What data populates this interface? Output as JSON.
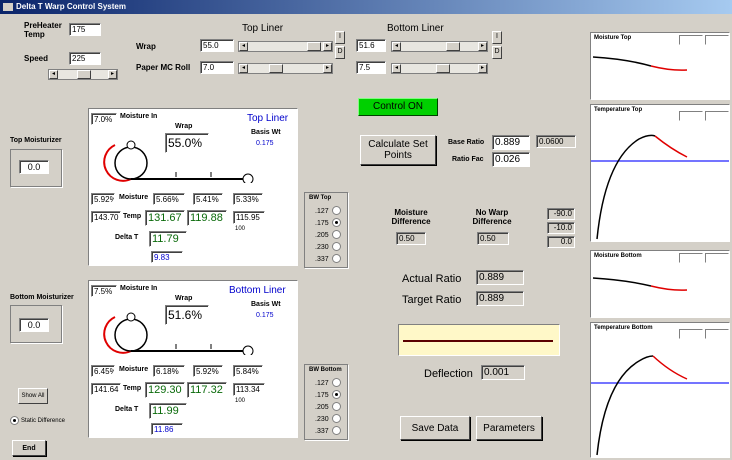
{
  "window": {
    "title": "Delta T Warp Control System"
  },
  "header": {
    "preheater_label": "PreHeater Temp",
    "preheater_value": "175",
    "speed_label": "Speed",
    "speed_value": "225",
    "wrap_label": "Wrap",
    "paper_mc_label": "Paper MC Roll",
    "top_liner_title": "Top Liner",
    "top_wrap_value": "55.0",
    "top_paper_value": "7.0",
    "bottom_liner_title": "Bottom Liner",
    "bottom_wrap_value": "51.6",
    "bottom_paper_value": "7.5",
    "i_label": "I",
    "d_label": "D"
  },
  "control_on": "Control ON",
  "calculate_label": "Calculate Set Points",
  "base_ratio_label": "Base Ratio",
  "base_ratio_value": "0.889",
  "base_ratio_extra": "0.0600",
  "ratio_fac_label": "Ratio Fac",
  "ratio_fac_value": "0.026",
  "moisture_diff_label": "Moisture Difference",
  "moisture_diff_value": "0.50",
  "no_warp_label": "No Warp Difference",
  "no_warp_value": "0.50",
  "side_values": [
    "-90.0",
    "-10.0",
    "0.0"
  ],
  "actual_ratio_label": "Actual Ratio",
  "actual_ratio_value": "0.889",
  "target_ratio_label": "Target Ratio",
  "target_ratio_value": "0.889",
  "deflection_label": "Deflection",
  "deflection_value": "0.001",
  "save_data_label": "Save Data",
  "parameters_label": "Parameters",
  "show_all_label": "Show All",
  "static_diff_label": "Static Difference",
  "end_label": "End",
  "top_moisturizer": {
    "label": "Top Moisturizer",
    "value": "0.0"
  },
  "bottom_moisturizer": {
    "label": "Bottom Moisturizer",
    "value": "0.0"
  },
  "top_panel": {
    "moisture_in_value": "7.0%",
    "moisture_in_label": "Moisture In",
    "wrap_label": "Wrap",
    "wrap_value": "55.0%",
    "title": "Top Liner",
    "basis_label": "Basis Wt",
    "basis_value": "0.175",
    "moisture_left": "5.92%",
    "moisture_label": "Moisture",
    "moisture_vals": [
      "5.66%",
      "5.41%",
      "5.33%"
    ],
    "temp_left": "143.70",
    "temp_label": "Temp",
    "temp_vals": [
      "131.67",
      "119.88",
      "115.95"
    ],
    "temp_sub": "100",
    "delta_label": "Delta T",
    "delta_value": "11.79",
    "delta_sub": "9.83"
  },
  "bottom_panel": {
    "moisture_in_value": "7.5%",
    "moisture_in_label": "Moisture In",
    "wrap_label": "Wrap",
    "wrap_value": "51.6%",
    "title": "Bottom Liner",
    "basis_label": "Basis Wt",
    "basis_value": "0.175",
    "moisture_left": "6.45%",
    "moisture_label": "Moisture",
    "moisture_vals": [
      "6.18%",
      "5.92%",
      "5.84%"
    ],
    "temp_left": "141.64",
    "temp_label": "Temp",
    "temp_vals": [
      "129.30",
      "117.32",
      "113.34"
    ],
    "temp_sub": "100",
    "delta_label": "Delta T",
    "delta_value": "11.99",
    "delta_sub": "11.86"
  },
  "bw_top": {
    "title": "BW Top",
    "options": [
      ".127",
      ".175",
      ".205",
      ".230",
      ".337"
    ],
    "selected": 1
  },
  "bw_bottom": {
    "title": "BW Bottom",
    "options": [
      ".127",
      ".175",
      ".205",
      ".230",
      ".337"
    ],
    "selected": 1
  },
  "charts": {
    "moisture_top": "Moisture Top",
    "temperature_top": "Temperature Top",
    "moisture_bottom": "Moisture Bottom",
    "temperature_bottom": "Temperature Bottom"
  },
  "colors": {
    "title_bar": "#0a246a",
    "control_on": "#00d000",
    "accent_blue": "#0000cc",
    "curve_red": "#e00000",
    "ref_blue": "#2020ff",
    "deflection_bg": "#fff8c8"
  }
}
